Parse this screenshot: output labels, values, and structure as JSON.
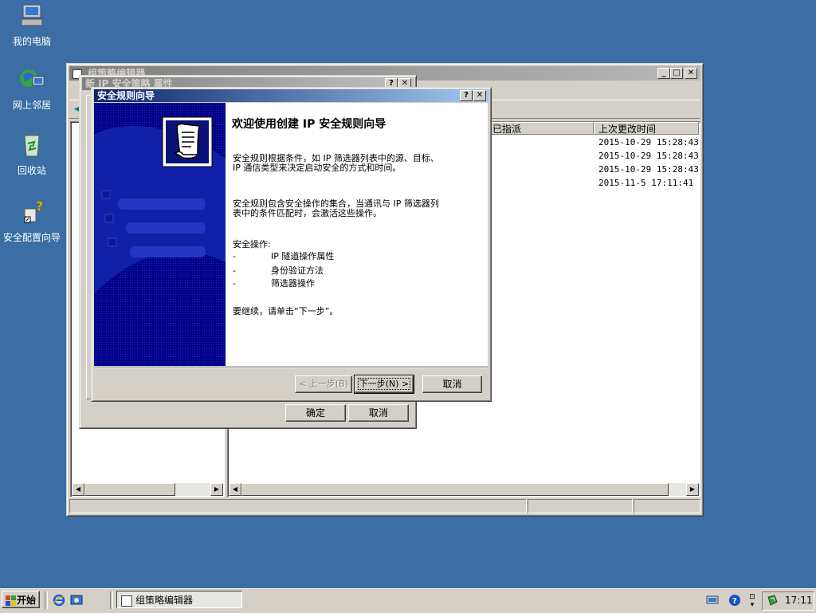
{
  "desktop": {
    "icons": [
      {
        "label": "我的电脑",
        "icon": "my-computer-icon"
      },
      {
        "label": "网上邻居",
        "icon": "network-places-icon"
      },
      {
        "label": "回收站",
        "icon": "recycle-bin-icon"
      },
      {
        "label": "安全配置向导",
        "icon": "security-wizard-icon"
      }
    ]
  },
  "gpedit": {
    "title": "组策略编辑器",
    "columns": [
      "已指派",
      "上次更改时间"
    ],
    "rows": [
      {
        "modified": "2015-10-29 15:28:43"
      },
      {
        "modified": "2015-10-29 15:28:43"
      },
      {
        "modified": "2015-10-29 15:28:43"
      },
      {
        "modified": "2015-11-5 17:11:41"
      }
    ]
  },
  "props_dialog": {
    "title": "新 IP 安全策略 属性",
    "ok_label": "确定",
    "cancel_label": "取消",
    "help_glyph": "?",
    "close_glyph": "✕"
  },
  "wizard": {
    "title": "安全规则向导",
    "heading": "欢迎使用创建 IP 安全规则向导",
    "para1_line1": "安全规则根据条件，如 IP 筛选器列表中的源、目标、",
    "para1_line2": "IP 通信类型来决定启动安全的方式和时间。",
    "para2_line1": "安全规则包含安全操作的集合，当通讯与 IP 筛选器列",
    "para2_line2": "表中的条件匹配时，会激活这些操作。",
    "ops_title": "安全操作:",
    "ops": [
      "IP 隧道操作属性",
      "身份验证方法",
      "筛选器操作"
    ],
    "bullet": "-",
    "continue_text": "要继续，请单击“下一步”。",
    "back_label": "< 上一步(B)",
    "next_label": "下一步(N) >",
    "cancel_label": "取消",
    "help_glyph": "?",
    "close_glyph": "✕"
  },
  "taskbar": {
    "start_label": "开始",
    "task_label": "组策略编辑器",
    "clock": "17:11"
  }
}
